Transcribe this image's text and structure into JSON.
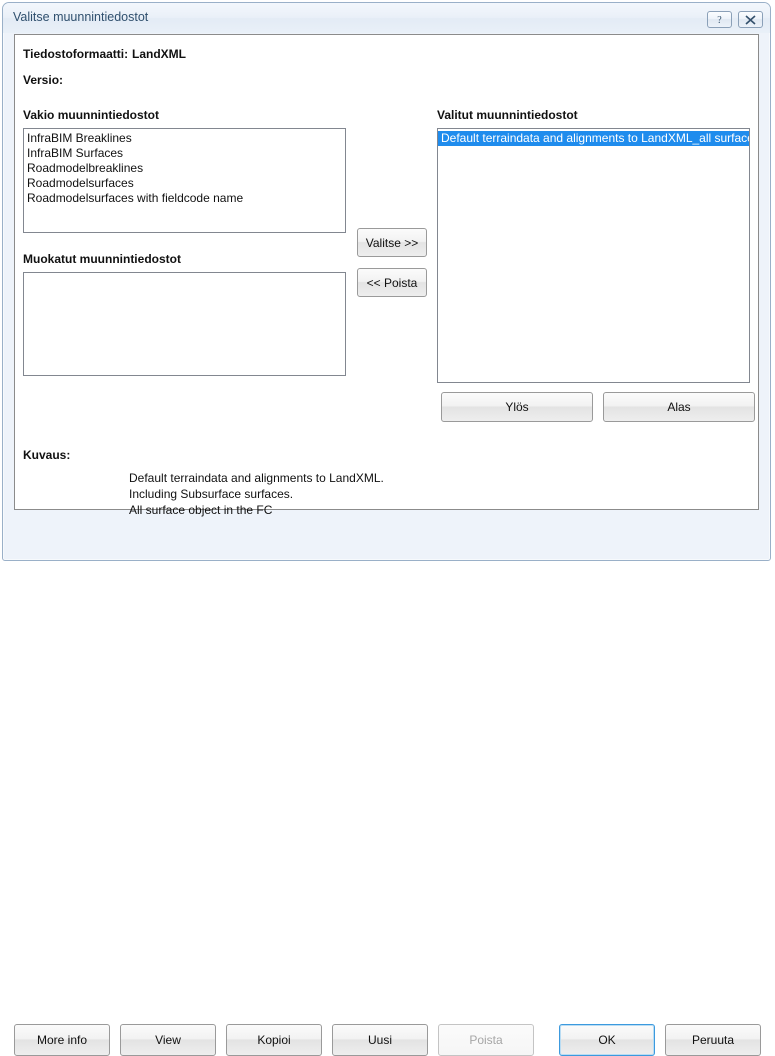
{
  "window": {
    "title": "Valitse muunnintiedostot",
    "help_icon": "question-mark-icon",
    "close_icon": "close-x-icon"
  },
  "info": {
    "format_label": "Tiedostoformaatti:",
    "format_value": "LandXML",
    "version_label": "Versio:",
    "version_value": ""
  },
  "standard": {
    "label": "Vakio muunnintiedostot",
    "items": [
      "InfraBIM Breaklines",
      "InfraBIM Surfaces",
      "Roadmodelbreaklines",
      "Roadmodelsurfaces",
      "Roadmodelsurfaces with fieldcode name"
    ]
  },
  "edited": {
    "label": "Muokatut muunnintiedostot",
    "items": []
  },
  "selected": {
    "label": "Valitut muunnintiedostot",
    "items": [
      "Default terraindata and alignments to LandXML_all surfaces"
    ],
    "selected_index": 0,
    "highlight_color": "#1f8ced"
  },
  "transfer": {
    "add_label": "Valitse >>",
    "remove_label": "<< Poista"
  },
  "order": {
    "up_label": "Ylös",
    "down_label": "Alas"
  },
  "description": {
    "label": "Kuvaus:",
    "text": "Default terraindata and alignments to LandXML.\nIncluding Subsurface surfaces.\nAll surface object in the FC"
  },
  "footer": {
    "more_info": "More info",
    "view": "View",
    "copy": "Kopioi",
    "new": "Uusi",
    "delete": "Poista",
    "ok": "OK",
    "cancel": "Peruuta",
    "focus_color": "#3c9ade"
  }
}
